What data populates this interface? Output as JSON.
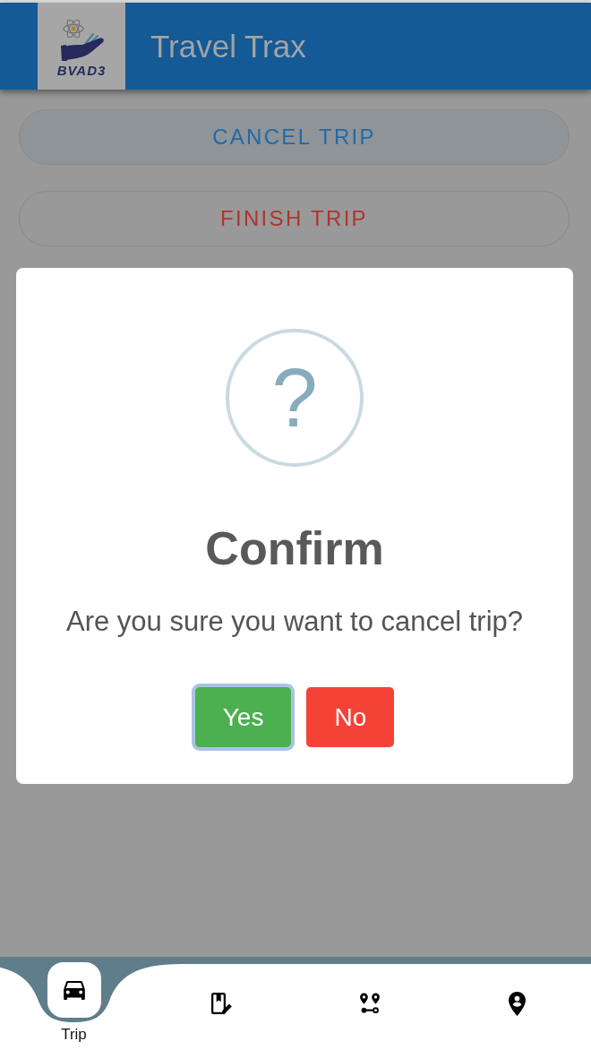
{
  "header": {
    "logo_text": "BVAD3",
    "title": "Travel Trax"
  },
  "actions": [
    {
      "label": "CANCEL TRIP",
      "kind": "cancel"
    },
    {
      "label": "FINISH TRIP",
      "kind": "finish"
    }
  ],
  "dialog": {
    "icon_text": "?",
    "title": "Confirm",
    "message": "Are you sure you want to cancel trip?",
    "buttons": [
      {
        "label": "Yes",
        "kind": "confirm",
        "focused": true
      },
      {
        "label": "No",
        "kind": "deny",
        "focused": false
      }
    ]
  },
  "bottom_nav": [
    {
      "kind": "car",
      "label": "Trip",
      "selected": true
    },
    {
      "kind": "logbook",
      "selected": false
    },
    {
      "kind": "route",
      "selected": false
    },
    {
      "kind": "place",
      "selected": false
    }
  ]
}
